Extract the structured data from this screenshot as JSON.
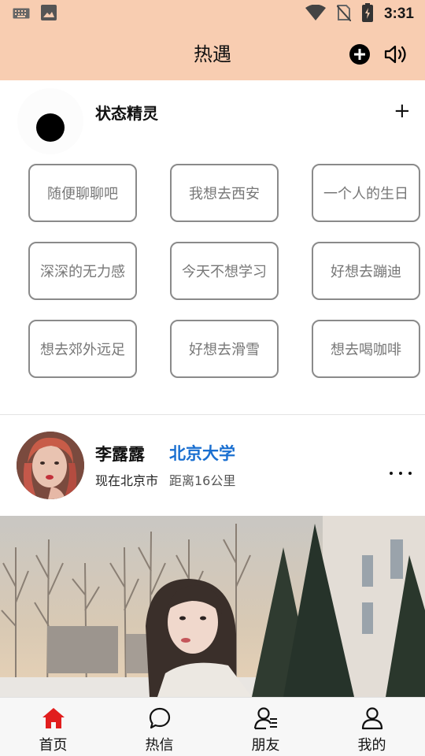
{
  "status_bar": {
    "time": "3:31",
    "icons": [
      "keyboard-icon",
      "image-icon",
      "wifi-icon",
      "no-sim-icon",
      "battery-icon"
    ]
  },
  "header": {
    "title": "热遇",
    "add_icon": "plus-circle-icon",
    "sound_icon": "speaker-icon"
  },
  "sprite": {
    "title": "状态精灵",
    "add_label": "+",
    "tags": [
      "随便聊聊吧",
      "我想去西安",
      "一个人的生日",
      "深深的无力感",
      "今天不想学习",
      "好想去蹦迪",
      "想去郊外远足",
      "好想去滑雪",
      "想去喝咖啡"
    ]
  },
  "post": {
    "name": "李露露",
    "school": "北京大学",
    "location": "现在北京市",
    "distance": "距离16公里"
  },
  "tabs": [
    {
      "label": "首页",
      "icon": "home-icon"
    },
    {
      "label": "热信",
      "icon": "chat-icon"
    },
    {
      "label": "朋友",
      "icon": "friends-icon"
    },
    {
      "label": "我的",
      "icon": "profile-icon"
    }
  ],
  "colors": {
    "header_bg": "#f8cdb1",
    "accent": "#1a6fd0",
    "active_tab": "#e11d1d"
  }
}
